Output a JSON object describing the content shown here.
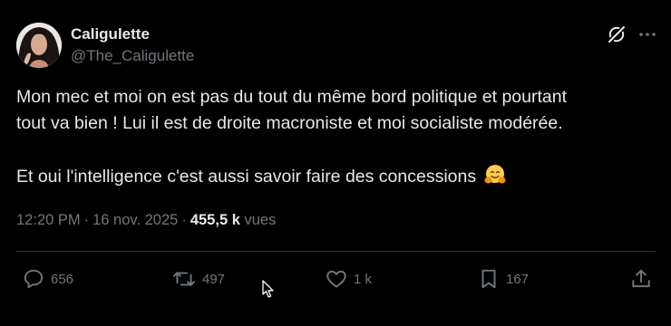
{
  "author": {
    "display_name": "Caligulette",
    "handle": "@The_Caligulette"
  },
  "tweet": {
    "line1": "Mon mec et moi on est pas du tout du même bord politique et pourtant",
    "line2": "tout va bien ! Lui il est de droite macroniste et moi socialiste modérée.",
    "line3": "Et oui l'intelligence c'est aussi savoir faire des concessions",
    "emoji": "hugging-face-emoji"
  },
  "meta": {
    "time": "12:20 PM",
    "separator": "·",
    "date": "16 nov. 2025",
    "views_count": "455,5 k",
    "views_label": "vues"
  },
  "actions": {
    "replies": "656",
    "reposts": "497",
    "likes": "1 k",
    "bookmarks": "167"
  },
  "colors": {
    "background": "#000000",
    "text": "#e7e9ea",
    "secondary": "#71767b",
    "divider": "#2f3336"
  }
}
